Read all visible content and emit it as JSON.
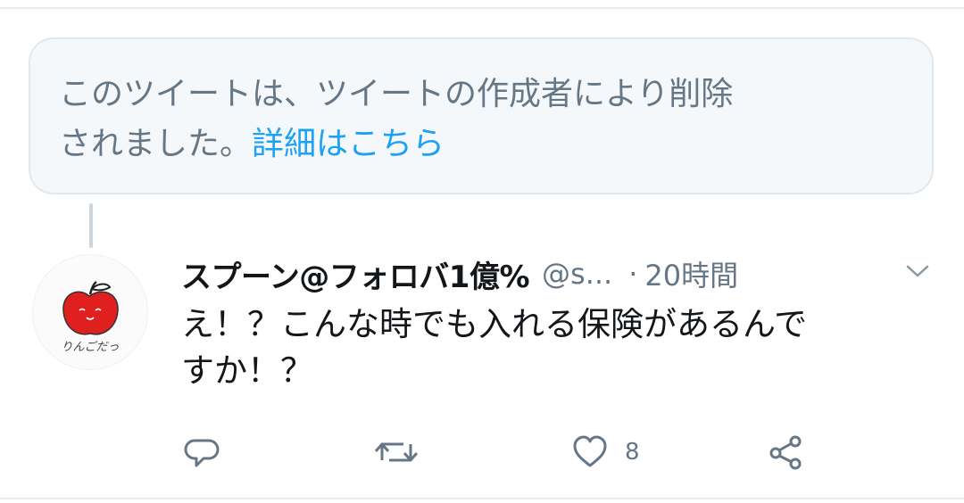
{
  "deleted_notice": {
    "line1": "このツイートは、ツイートの作成者により削除",
    "line2_text": "されました。",
    "link": "詳細はこちら"
  },
  "avatar": {
    "caption": "りんごだっ"
  },
  "tweet": {
    "display_name": "スプーン@フォロバ1億%",
    "handle": "@s...",
    "separator": "·",
    "time": "20時間",
    "text_line1": "え！？こんな時でも入れる保険があるんで",
    "text_line2": "すか！？"
  },
  "actions": {
    "like_count": "8"
  },
  "colors": {
    "link": "#1da1f2",
    "secondary_text": "#657786",
    "primary_text": "#14171a",
    "apple_red": "#e0201e",
    "box_background": "#f5f8fa"
  },
  "icons": [
    "reply-icon",
    "retweet-icon",
    "like-icon",
    "share-icon",
    "chevron-down-icon"
  ]
}
